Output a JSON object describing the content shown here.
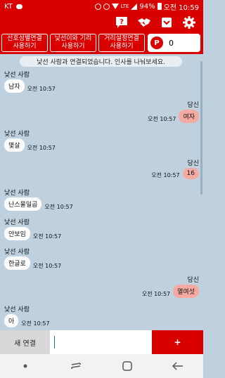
{
  "status_bar": {
    "carrier": "KT",
    "network": "LTE",
    "battery": "94%",
    "time": "오전 10:59"
  },
  "toolbar": {
    "icons": [
      "help-icon",
      "handshake-icon",
      "inbox-icon",
      "settings-icon"
    ]
  },
  "modes": [
    {
      "line1": "선호성별연결",
      "line2": "사용하기"
    },
    {
      "line1": "낯선이와 기리",
      "line2": "사용하기"
    },
    {
      "line1": "거리설정연결",
      "line2": "사용하기"
    }
  ],
  "points": {
    "badge": "P",
    "value": "0"
  },
  "chat": {
    "notice": "낯선 사람과 연결되었습니다. 인사를 나눠보세요.",
    "messages": [
      {
        "from": "stranger",
        "sender": "낯선 사람",
        "text": "남자",
        "time": "오전 10:57"
      },
      {
        "from": "me",
        "sender": "당신",
        "text": "여자",
        "time": "오전 10:57"
      },
      {
        "from": "stranger",
        "sender": "낯선 사람",
        "text": "몇살",
        "time": "오전 10:57"
      },
      {
        "from": "me",
        "sender": "당신",
        "text": "16",
        "time": "오전 10:57"
      },
      {
        "from": "stranger",
        "sender": "낯선 사람",
        "text": "난스물일곱",
        "time": "오전 10:57"
      },
      {
        "from": "stranger",
        "sender": "낯선 사람",
        "text": "안보임",
        "time": "오전 10:57"
      },
      {
        "from": "stranger",
        "sender": "낯선 사람",
        "text": "한글로",
        "time": "오전 10:57"
      },
      {
        "from": "me",
        "sender": "당신",
        "text": "열여섯",
        "time": "오전 10:57"
      },
      {
        "from": "stranger",
        "sender": "낯선 사람",
        "text": "아",
        "time": "오전 10:57"
      }
    ]
  },
  "input_bar": {
    "new_chat_label": "새 연결",
    "input_value": "",
    "send_label": "+"
  },
  "nav": {
    "icons": [
      "dot-icon",
      "recent-apps-icon",
      "home-icon",
      "back-icon"
    ]
  },
  "colors": {
    "accent": "#d90000",
    "chat_bg": "#bfd1de",
    "my_bubble": "#f4aaa2",
    "their_bubble": "#ffffff"
  }
}
